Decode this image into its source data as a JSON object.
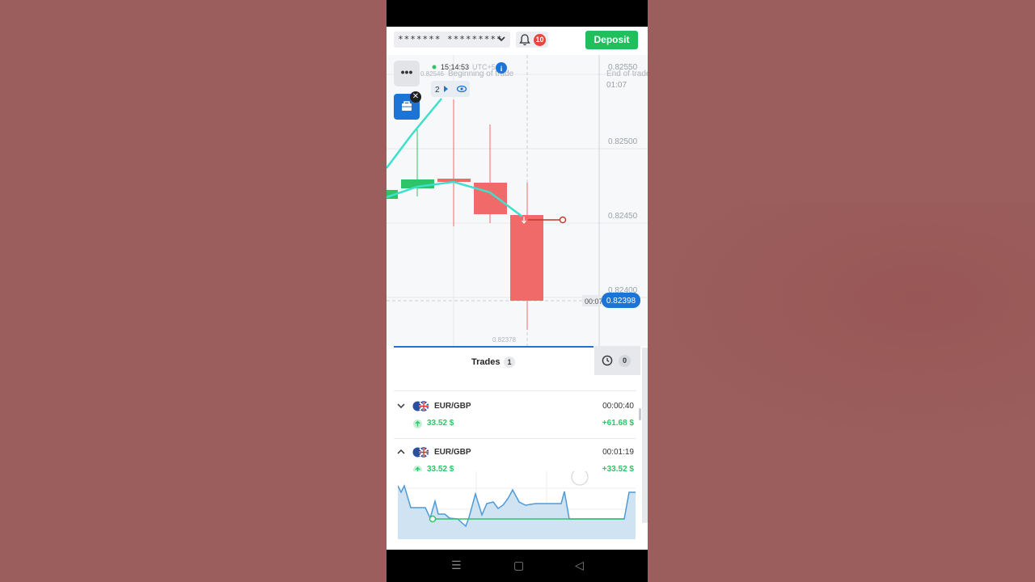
{
  "header": {
    "account_mask": "******* *********",
    "notifications": "10",
    "deposit_label": "Deposit"
  },
  "chart": {
    "time": "15:14:53",
    "tz": "UTC+5",
    "price_axis": [
      "0.82550",
      "0.82500",
      "0.82450",
      "0.82400"
    ],
    "start_price": "0.82546",
    "begin_label": "Beginning of trade",
    "end_label": "End of trade",
    "end_time": "01:07",
    "low_label": "0.82378",
    "countdown": "00:07",
    "current_price": "0.82398",
    "trade_count": "2",
    "colors": {
      "bull": "#2ec468",
      "bear": "#f06a6a",
      "accent": "#1b74d6",
      "line": "#3ee0cc"
    }
  },
  "trades": {
    "tab_label": "Trades",
    "tab_count": "1",
    "history_count": "0",
    "items": [
      {
        "pair": "EUR/GBP",
        "timer": "00:00:40",
        "amount": "33.52 $",
        "profit": "+61.68 $"
      },
      {
        "pair": "EUR/GBP",
        "timer": "00:01:19",
        "amount": "33.52 $",
        "profit": "+33.52 $"
      }
    ]
  },
  "icons": [
    "chevron-down-icon",
    "bell-icon",
    "more-icon",
    "briefcase-icon",
    "close-icon",
    "info-icon",
    "eye-icon",
    "play-icon",
    "clock-icon",
    "flag-icon",
    "arrow-up-icon",
    "chevron-up-icon"
  ],
  "navbar": {
    "menu": "☰",
    "home": "▢",
    "back": "◁"
  }
}
